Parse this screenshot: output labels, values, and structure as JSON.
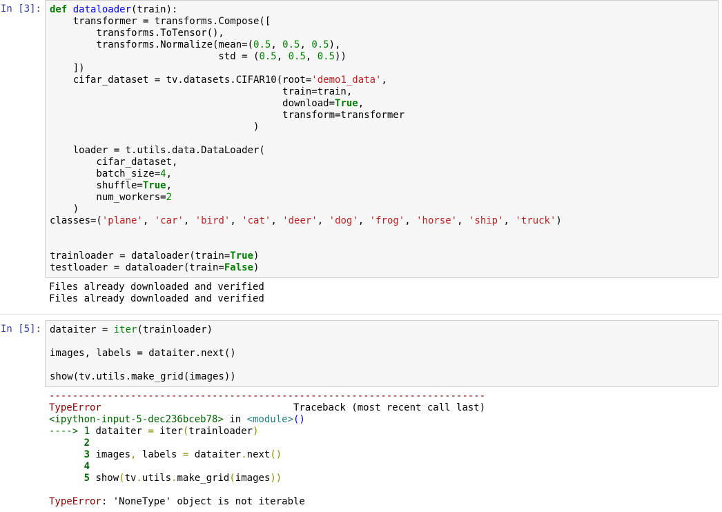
{
  "cell1": {
    "prompt": "In [3]:",
    "code": {
      "l1_def": "def",
      "l1_fn": " dataloader",
      "l1_rest": "(train):",
      "l2": "    transformer = transforms.Compose([",
      "l3": "        transforms.ToTensor(),",
      "l4a": "        transforms.Normalize(mean=(",
      "l4n1": "0.5",
      "l4c": ", ",
      "l4n2": "0.5",
      "l4n3": "0.5",
      "l4end": "),",
      "l5a": "                             std = (",
      "l5n1": "0.5",
      "l5n2": "0.5",
      "l5n3": "0.5",
      "l5end": "))",
      "l6": "    ])",
      "l7a": "    cifar_dataset = tv.datasets.CIFAR10(root=",
      "l7s": "'demo1_data'",
      "l7end": ",",
      "l8a": "                                        train=train,",
      "l9a": "                                        download=",
      "l9b": "True",
      "l9end": ",",
      "l10": "                                        transform=transformer",
      "l11": "                                   )",
      "l12": "",
      "l13": "    loader = t.utils.data.DataLoader(",
      "l14": "        cifar_dataset,",
      "l15a": "        batch_size=",
      "l15n": "4",
      "l15end": ",",
      "l16a": "        shuffle=",
      "l16b": "True",
      "l16end": ",",
      "l17a": "        num_workers=",
      "l17n": "2",
      "l18": "    )",
      "l19a": "classes=(",
      "l19s1": "'plane'",
      "l19s2": "'car'",
      "l19s3": "'bird'",
      "l19s4": "'cat'",
      "l19s5": "'deer'",
      "l19s6": "'dog'",
      "l19s7": "'frog'",
      "l19s8": "'horse'",
      "l19s9": "'ship'",
      "l19s10": "'truck'",
      "l19end": ")",
      "l20": "",
      "l21": "",
      "l22a": "trainloader = dataloader(train=",
      "l22b": "True",
      "l22end": ")",
      "l23a": "testloader = dataloader(train=",
      "l23b": "False",
      "l23end": ")"
    },
    "output": "Files already downloaded and verified\nFiles already downloaded and verified"
  },
  "cell2": {
    "prompt": "In [5]:",
    "code": {
      "l1a": "dataiter = ",
      "l1iter": "iter",
      "l1b": "(trainloader)",
      "l2": "",
      "l3": "images, labels = dataiter.next()",
      "l4": "",
      "l5": "show(tv.utils.make_grid(images))"
    },
    "traceback": {
      "dashline": "---------------------------------------------------------------------------",
      "err_name": "TypeError",
      "tb_label": "                                 Traceback (most recent call last)",
      "loc_a": "<ipython-input-5-dec236bceb78>",
      "loc_in": " in ",
      "loc_mod": "<module>",
      "loc_paren": "()",
      "arrow": "----> 1",
      "l1_a": " dataiter ",
      "l1_eq": "=",
      "l1_b": " iter",
      "l1_c": "(",
      "l1_d": "trainloader",
      "l1_e": ")",
      "ln2": "      2",
      "ln3": "      3",
      "l3_a": " images",
      "l3_c1": ",",
      "l3_b": " labels ",
      "l3_eq": "=",
      "l3_c": " dataiter",
      "l3_dot": ".",
      "l3_d": "next",
      "l3_p": "()",
      "ln4": "      4",
      "ln5": "      5",
      "l5_a": " show",
      "l5_p1": "(",
      "l5_b": "tv",
      "l5_d1": ".",
      "l5_c": "utils",
      "l5_d2": ".",
      "l5_d": "make_grid",
      "l5_p2": "(",
      "l5_e": "images",
      "l5_p3": "))",
      "final_err": "TypeError",
      "final_msg": ": 'NoneType' object is not iterable"
    }
  }
}
